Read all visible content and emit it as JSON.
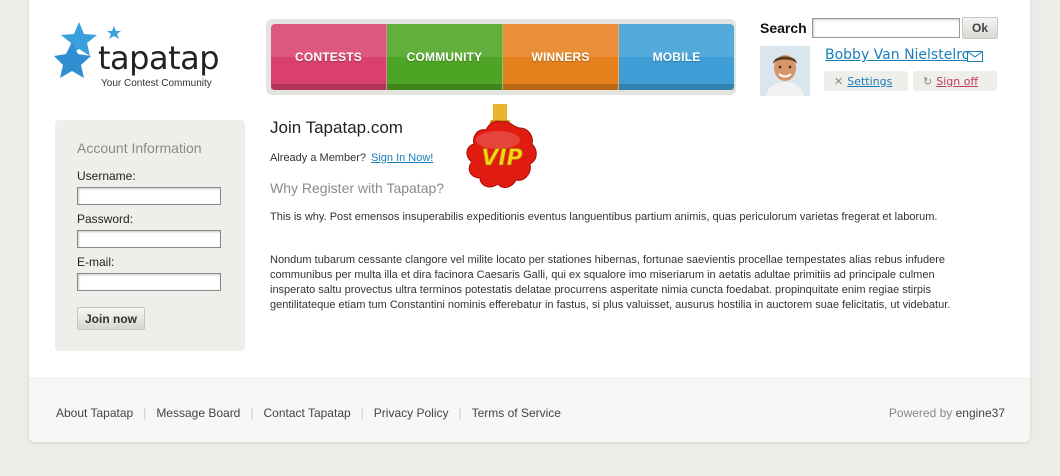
{
  "logo": {
    "name": "tapatap",
    "tagline": "Your Contest Community"
  },
  "nav": [
    {
      "label": "CONTESTS",
      "color": "#d9406f"
    },
    {
      "label": "COMMUNITY",
      "color": "#4ea424"
    },
    {
      "label": "WINNERS",
      "color": "#e5801c"
    },
    {
      "label": "MOBILE",
      "color": "#3d9fd6"
    }
  ],
  "search": {
    "label": "Search",
    "value": "",
    "button": "Ok"
  },
  "user": {
    "name": "Bobby Van Nielstelroy",
    "settings": "Settings",
    "signoff": "Sign off"
  },
  "account": {
    "title": "Account Information",
    "username_label": "Username:",
    "username_value": "",
    "password_label": "Password:",
    "password_value": "",
    "email_label": "E-mail:",
    "email_value": "",
    "join_button": "Join now"
  },
  "main": {
    "title": "Join Tapatap.com",
    "member_prompt": "Already a Member?",
    "signin_link": "Sign In Now!",
    "badge": "VIP",
    "why_heading": "Why Register with Tapatap?",
    "para1": "This is why. Post emensos insuperabilis expeditionis eventus languentibus partium animis, quas periculorum varietas fregerat et laborum.",
    "para2": "Nondum tubarum cessante clangore vel milite locato per stationes hibernas, fortunae saevientis procellae tempestates alias rebus infudere communibus per multa illa et dira facinora Caesaris Galli, qui ex squalore imo miseriarum in aetatis adultae primitiis ad principale culmen insperato saltu provectus ultra terminos potestatis delatae procurrens asperitate nimia cuncta foedabat. propinquitate enim regiae stirpis gentilitateque etiam tum Constantini nominis efferebatur in fastus, si plus valuisset, ausurus hostilia in auctorem suae felicitatis, ut videbatur."
  },
  "footer": {
    "links": [
      "About Tapatap",
      "Message Board",
      "Contact Tapatap",
      "Privacy Policy",
      "Terms of Service"
    ],
    "powered_prefix": "Powered by",
    "powered_name": "engine37"
  }
}
